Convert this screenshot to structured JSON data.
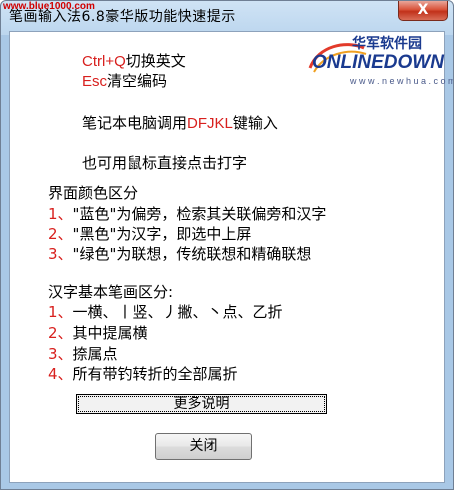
{
  "window": {
    "title": "笔画输入法6.8豪华版功能快速提示",
    "watermark": "www.blue1000.com"
  },
  "logo": {
    "brand_cn": "华军软件园",
    "brand_en": "ONLINEDOWN",
    "url": "w w w . n e w h u a . c o m"
  },
  "tips": {
    "line1_key": "Ctrl+Q",
    "line1_text": "切换英文",
    "line2_key": "Esc",
    "line2_text": "清空编码",
    "line3_pre": "笔记本电脑调用",
    "line3_key": "DFJKL",
    "line3_post": "键输入",
    "line4": "也可用鼠标直接点击打字"
  },
  "colors_section": {
    "heading": "界面颜色区分",
    "items": [
      {
        "num": "1、",
        "text": "\"蓝色\"为偏旁，检索其关联偏旁和汉字"
      },
      {
        "num": "2、",
        "text": "\"黑色\"为汉字，即选中上屏"
      },
      {
        "num": "3、",
        "text": "\"绿色\"为联想，传统联想和精确联想"
      }
    ]
  },
  "strokes_section": {
    "heading": "汉字基本笔画区分:",
    "items": [
      {
        "num": "1、",
        "text": "一横、丨竖、丿撇、丶点、乙折"
      },
      {
        "num": "2、",
        "text": "其中提属横"
      },
      {
        "num": "3、",
        "text": "捺属点"
      },
      {
        "num": "4、",
        "text": "所有带钓转折的全部属折"
      }
    ]
  },
  "buttons": {
    "more": "更多说明",
    "close": "关闭",
    "title_close": "X"
  },
  "colors": {
    "accent_red": "#d8201e",
    "title_gradient": "#bcd6ee",
    "close_red": "#c1311a"
  }
}
